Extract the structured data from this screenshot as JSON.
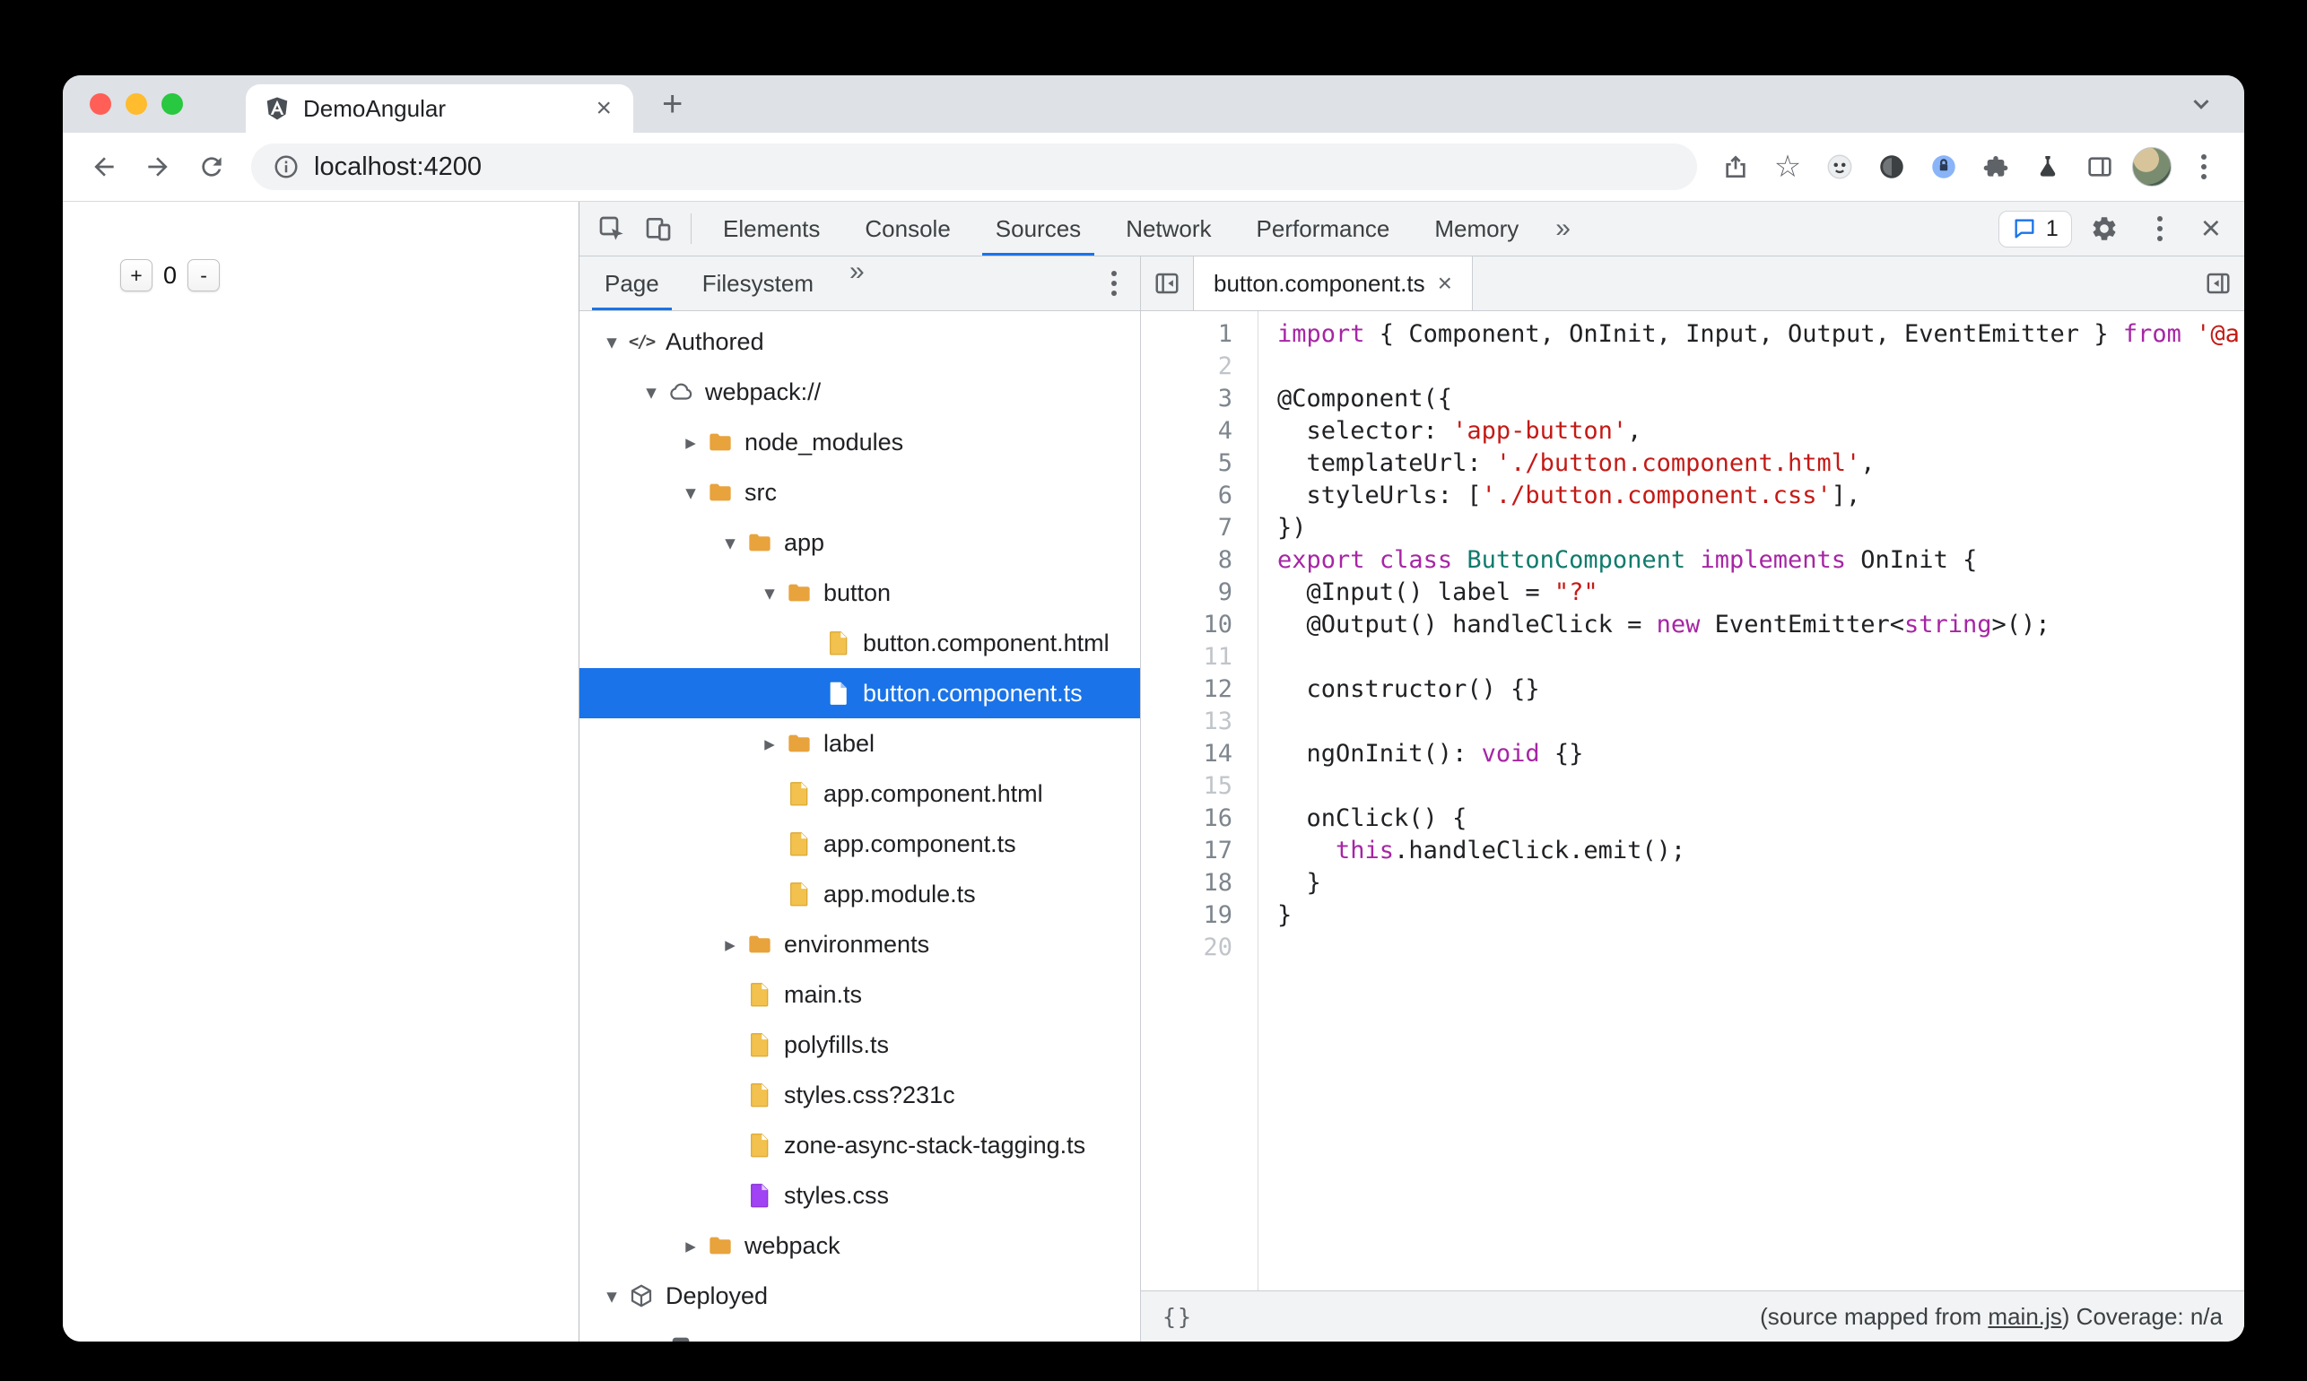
{
  "colors": {
    "accent": "#1a73e8",
    "selection": "#1a73e8",
    "folder": "#e8a33d",
    "file_yellow": "#f2c14e",
    "file_purple": "#a142f4",
    "token_keyword": "#a626a4",
    "token_string": "#c41a16",
    "token_class": "#0f7b6c",
    "traffic_lights": [
      "#ff5f57",
      "#febc2e",
      "#28c840"
    ]
  },
  "glyphs": {
    "close": "×",
    "more_tabs": "»",
    "new_tab": "+"
  },
  "browser": {
    "tab": {
      "title": "DemoAngular"
    },
    "url": "localhost:4200"
  },
  "page": {
    "plus_label": "+",
    "count": "0",
    "minus_label": "-"
  },
  "devtools": {
    "toolbar": {
      "tabs": [
        "Elements",
        "Console",
        "Sources",
        "Network",
        "Performance",
        "Memory"
      ],
      "active_tab": "Sources",
      "messages_count": "1"
    },
    "navigator": {
      "tabs": [
        "Page",
        "Filesystem"
      ],
      "active_tab": "Page",
      "tree": [
        {
          "label": "Authored",
          "level": 0,
          "icon": "code",
          "arrow": "open"
        },
        {
          "label": "webpack://",
          "level": 1,
          "icon": "cloud",
          "arrow": "open"
        },
        {
          "label": "node_modules",
          "level": 2,
          "icon": "folder",
          "arrow": "closed"
        },
        {
          "label": "src",
          "level": 2,
          "icon": "folder",
          "arrow": "open"
        },
        {
          "label": "app",
          "level": 3,
          "icon": "folder",
          "arrow": "open"
        },
        {
          "label": "button",
          "level": 4,
          "icon": "folder",
          "arrow": "open"
        },
        {
          "label": "button.component.html",
          "level": 5,
          "icon": "file",
          "arrow": "none"
        },
        {
          "label": "button.component.ts",
          "level": 5,
          "icon": "file_white",
          "arrow": "none",
          "selected": true
        },
        {
          "label": "label",
          "level": 4,
          "icon": "folder",
          "arrow": "closed"
        },
        {
          "label": "app.component.html",
          "level": 4,
          "icon": "file",
          "arrow": "none"
        },
        {
          "label": "app.component.ts",
          "level": 4,
          "icon": "file",
          "arrow": "none"
        },
        {
          "label": "app.module.ts",
          "level": 4,
          "icon": "file",
          "arrow": "none"
        },
        {
          "label": "environments",
          "level": 3,
          "icon": "folder",
          "arrow": "closed"
        },
        {
          "label": "main.ts",
          "level": 3,
          "icon": "file",
          "arrow": "none"
        },
        {
          "label": "polyfills.ts",
          "level": 3,
          "icon": "file",
          "arrow": "none"
        },
        {
          "label": "styles.css?231c",
          "level": 3,
          "icon": "file",
          "arrow": "none"
        },
        {
          "label": "zone-async-stack-tagging.ts",
          "level": 3,
          "icon": "file",
          "arrow": "none"
        },
        {
          "label": "styles.css",
          "level": 3,
          "icon": "file_purple",
          "arrow": "none"
        },
        {
          "label": "webpack",
          "level": 2,
          "icon": "folder",
          "arrow": "closed"
        },
        {
          "label": "Deployed",
          "level": 0,
          "icon": "cube",
          "arrow": "open"
        },
        {
          "label": "",
          "level": 1,
          "icon": "dark",
          "arrow": "none"
        }
      ]
    },
    "editor": {
      "tab_title": "button.component.ts",
      "lines": [
        {
          "n": 1,
          "segs": [
            [
              "kw",
              "import"
            ],
            [
              "pl",
              " { Component, OnInit, Input, Output, EventEmitter } "
            ],
            [
              "kw",
              "from"
            ],
            [
              "pl",
              " "
            ],
            [
              "str",
              "'@a"
            ]
          ]
        },
        {
          "n": 2,
          "segs": []
        },
        {
          "n": 3,
          "segs": [
            [
              "pl",
              "@Component({"
            ]
          ]
        },
        {
          "n": 4,
          "segs": [
            [
              "pl",
              "  selector: "
            ],
            [
              "str",
              "'app-button'"
            ],
            [
              "pl",
              ","
            ]
          ]
        },
        {
          "n": 5,
          "segs": [
            [
              "pl",
              "  templateUrl: "
            ],
            [
              "str",
              "'./button.component.html'"
            ],
            [
              "pl",
              ","
            ]
          ]
        },
        {
          "n": 6,
          "segs": [
            [
              "pl",
              "  styleUrls: ["
            ],
            [
              "str",
              "'./button.component.css'"
            ],
            [
              "pl",
              "],"
            ]
          ]
        },
        {
          "n": 7,
          "segs": [
            [
              "pl",
              "})"
            ]
          ]
        },
        {
          "n": 8,
          "segs": [
            [
              "kw",
              "export"
            ],
            [
              "pl",
              " "
            ],
            [
              "kw",
              "class"
            ],
            [
              "pl",
              " "
            ],
            [
              "cls",
              "ButtonComponent"
            ],
            [
              "pl",
              " "
            ],
            [
              "kw",
              "implements"
            ],
            [
              "pl",
              " OnInit {"
            ]
          ]
        },
        {
          "n": 9,
          "segs": [
            [
              "pl",
              "  @Input() label = "
            ],
            [
              "str",
              "\"?\""
            ]
          ]
        },
        {
          "n": 10,
          "segs": [
            [
              "pl",
              "  @Output() handleClick = "
            ],
            [
              "kw",
              "new"
            ],
            [
              "pl",
              " EventEmitter<"
            ],
            [
              "kw",
              "string"
            ],
            [
              "pl",
              ">();"
            ]
          ]
        },
        {
          "n": 11,
          "segs": []
        },
        {
          "n": 12,
          "segs": [
            [
              "pl",
              "  constructor() {}"
            ]
          ]
        },
        {
          "n": 13,
          "segs": []
        },
        {
          "n": 14,
          "segs": [
            [
              "pl",
              "  ngOnInit(): "
            ],
            [
              "kw",
              "void"
            ],
            [
              "pl",
              " {}"
            ]
          ]
        },
        {
          "n": 15,
          "segs": []
        },
        {
          "n": 16,
          "segs": [
            [
              "pl",
              "  onClick() {"
            ]
          ]
        },
        {
          "n": 17,
          "segs": [
            [
              "pl",
              "    "
            ],
            [
              "kw",
              "this"
            ],
            [
              "pl",
              ".handleClick.emit();"
            ]
          ]
        },
        {
          "n": 18,
          "segs": [
            [
              "pl",
              "  }"
            ]
          ]
        },
        {
          "n": 19,
          "segs": [
            [
              "pl",
              "}"
            ]
          ]
        },
        {
          "n": 20,
          "segs": []
        }
      ],
      "status": {
        "pretty_print": "{}",
        "prefix": "(source mapped from ",
        "link": "main.js",
        "suffix": ") Coverage: n/a"
      }
    }
  }
}
